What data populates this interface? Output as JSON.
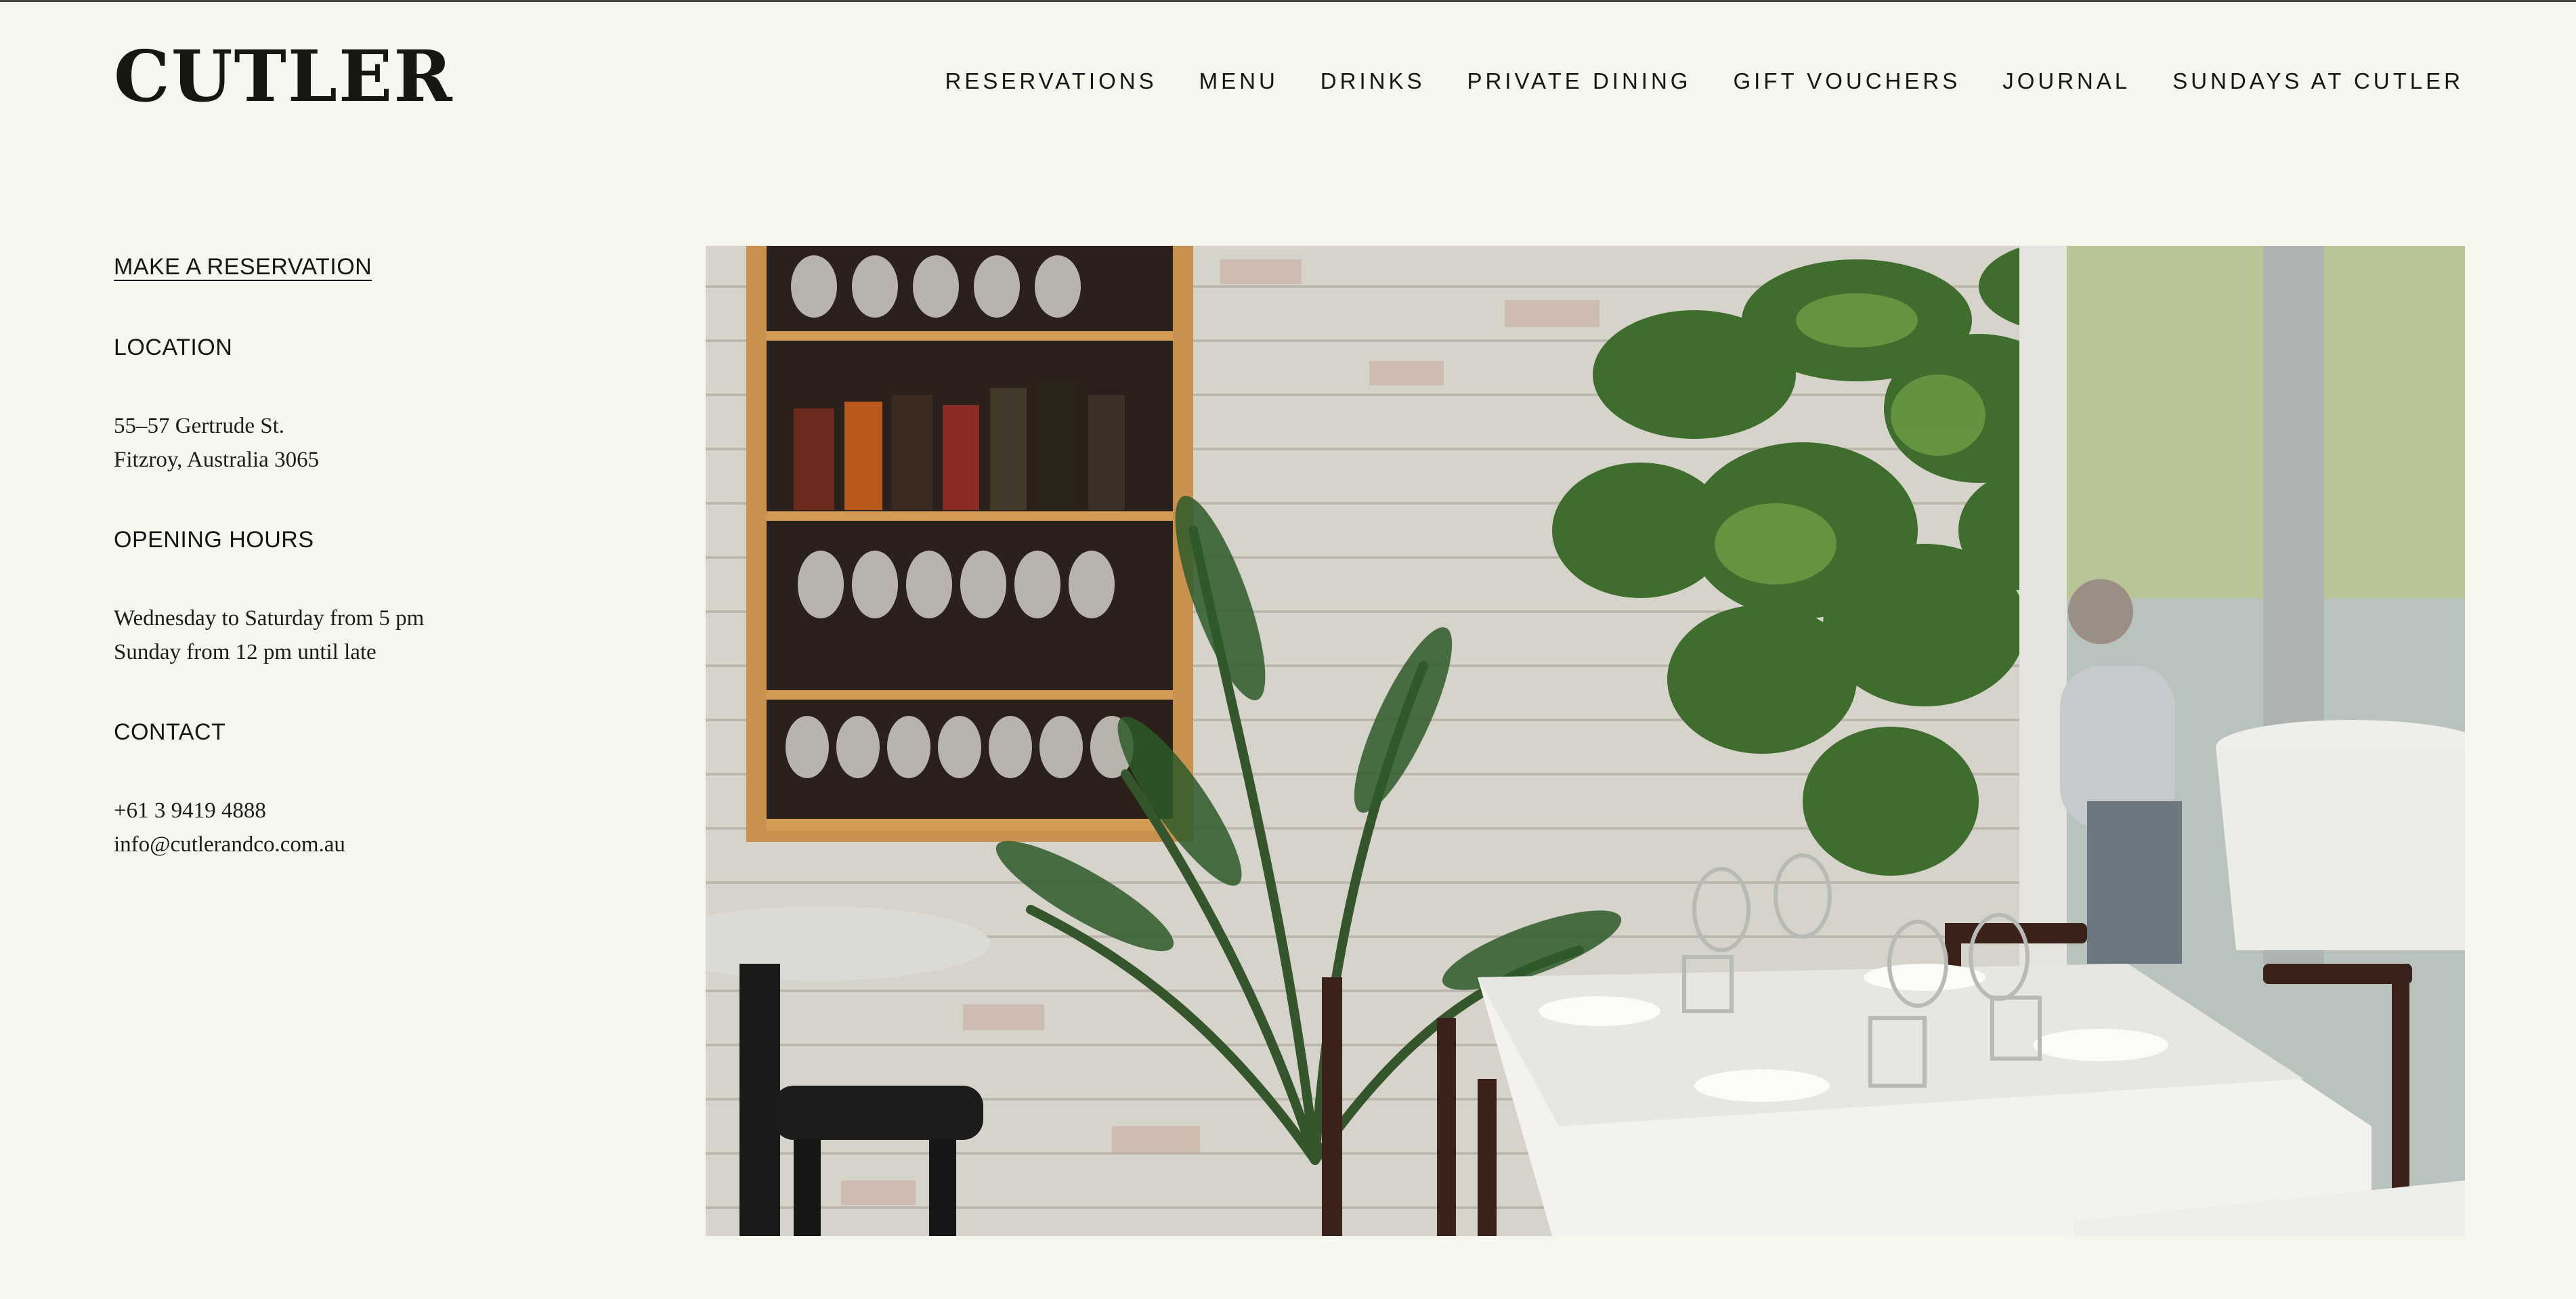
{
  "header": {
    "logo_text": "CUTLER",
    "nav": [
      {
        "label": "RESERVATIONS"
      },
      {
        "label": "MENU"
      },
      {
        "label": "DRINKS"
      },
      {
        "label": "PRIVATE DINING"
      },
      {
        "label": "GIFT VOUCHERS"
      },
      {
        "label": "JOURNAL"
      },
      {
        "label": "SUNDAYS AT CUTLER"
      }
    ]
  },
  "sidebar": {
    "reservation_link": "MAKE A RESERVATION",
    "location": {
      "heading": "LOCATION",
      "line1": "55–57 Gertrude St.",
      "line2": "Fitzroy, Australia 3065"
    },
    "hours": {
      "heading": "OPENING HOURS",
      "line1": "Wednesday to Saturday from 5 pm",
      "line2": "Sunday from 12 pm until late"
    },
    "contact": {
      "heading": "CONTACT",
      "phone": "+61 3 9419 4888",
      "email": "info@cutlerandco.com.au"
    }
  },
  "colors": {
    "background": "#f6f5ee",
    "text": "#161612"
  }
}
